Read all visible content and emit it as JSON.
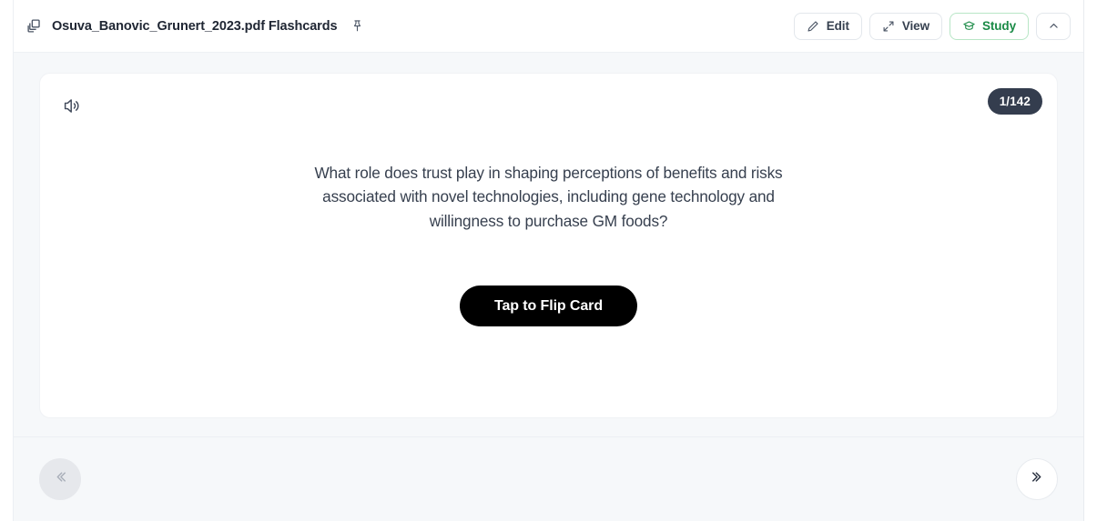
{
  "header": {
    "doc_icon": "copy-layers-icon",
    "title": "Osuva_Banovic_Grunert_2023.pdf Flashcards",
    "pin_icon": "pushpin-icon",
    "buttons": [
      {
        "label": "Edit",
        "icon": "pencil-icon"
      },
      {
        "label": "View",
        "icon": "expand-arrows-icon"
      },
      {
        "label": "Study",
        "icon": "graduation-cap-icon",
        "active": true
      }
    ],
    "collapse_icon": "chevron-up-icon"
  },
  "card": {
    "speaker_icon": "speaker-volume-icon",
    "counter": "1/142",
    "current_index": 1,
    "total": 142,
    "question": "What role does trust play in shaping perceptions of benefits and risks associated with novel technologies, including gene technology and willingness to purchase GM foods?",
    "flip_label": "Tap to Flip Card"
  },
  "footer": {
    "prev_icon": "chevron-double-left-icon",
    "next_icon": "chevron-double-right-icon",
    "prev_disabled": true,
    "next_disabled": false
  },
  "colors": {
    "page_background": "#f6f8fa",
    "card_background": "#ffffff",
    "badge_background": "#343d4e",
    "flip_button_background": "#000000",
    "study_accent": "#1a8a46",
    "text_primary": "#1f2633",
    "text_body": "#363f4e"
  }
}
